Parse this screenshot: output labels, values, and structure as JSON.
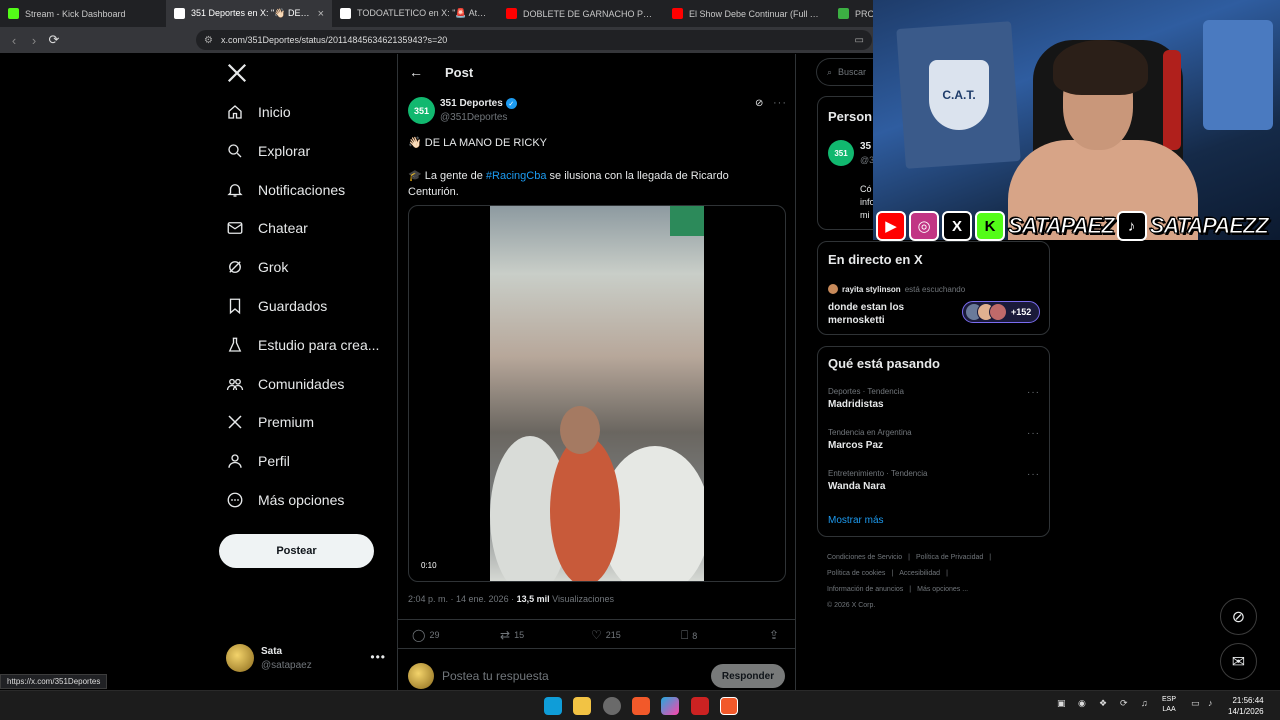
{
  "browser": {
    "tabs": [
      {
        "title": "Stream - Kick Dashboard",
        "color": "#53fc18",
        "active": false
      },
      {
        "title": "351 Deportes en X: \"👋🏻 DE LA M",
        "color": "#ffffff",
        "active": true
      },
      {
        "title": "TODOATLETICO en X: \"🚨 Atención",
        "color": "#ffffff",
        "active": false
      },
      {
        "title": "DOBLETE DE GARNACHO PERO LA P",
        "color": "#ff0000",
        "active": false
      },
      {
        "title": "El Show Debe Continuar (Full Album)",
        "color": "#ff0000",
        "active": false
      },
      {
        "title": "PROMIE",
        "color": "#3cb043",
        "active": false
      }
    ],
    "url": "x.com/351Deportes/status/2011484563462135943?s=20",
    "status_url": "https://x.com/351Deportes"
  },
  "nav": {
    "items": [
      {
        "label": "Inicio",
        "icon": "home-icon"
      },
      {
        "label": "Explorar",
        "icon": "search-icon"
      },
      {
        "label": "Notificaciones",
        "icon": "bell-icon"
      },
      {
        "label": "Chatear",
        "icon": "mail-icon"
      },
      {
        "label": "Grok",
        "icon": "grok-icon"
      },
      {
        "label": "Guardados",
        "icon": "bookmark-icon"
      },
      {
        "label": "Estudio para crea...",
        "icon": "flask-icon"
      },
      {
        "label": "Comunidades",
        "icon": "people-icon"
      },
      {
        "label": "Premium",
        "icon": "x-logo-icon"
      },
      {
        "label": "Perfil",
        "icon": "person-icon"
      },
      {
        "label": "Más opciones",
        "icon": "more-circle-icon"
      }
    ],
    "post_button": "Postear",
    "account": {
      "name": "Sata",
      "handle": "@satapaez"
    }
  },
  "post": {
    "header": "Post",
    "author": {
      "name": "351 Deportes",
      "handle": "@351Deportes",
      "avatar_text": "351"
    },
    "line1": "👋🏻 DE LA MANO DE RICKY",
    "line2_prefix": "🎓 La gente de ",
    "hashtag": "#RacingCba",
    "line2_suffix": " se ilusiona con la llegada de Ricardo Centurión.",
    "video_duration": "0:10",
    "time": "2:04 p. m. · 14 ene. 2026 · ",
    "views_count": "13,5 mil",
    "views_label": " Visualizaciones",
    "stats": {
      "replies": "29",
      "reposts": "15",
      "likes": "215",
      "bookmarks": "8"
    },
    "reply_placeholder": "Postea tu respuesta",
    "reply_button": "Responder"
  },
  "sidebar": {
    "search_placeholder": "Buscar",
    "persons": {
      "title": "Person",
      "name": "35",
      "handle": "@3",
      "text_lines": [
        "Có",
        "info",
        "mi"
      ]
    },
    "live": {
      "title": "En directo en X",
      "host": "rayita stylinson",
      "host_status": "está escuchando",
      "space_title": "donde estan los mernosketti",
      "listeners": "+152"
    },
    "trends": {
      "title": "Qué está pasando",
      "items": [
        {
          "context": "Deportes · Tendencia",
          "name": "Madridistas"
        },
        {
          "context": "Tendencia en Argentina",
          "name": "Marcos Paz"
        },
        {
          "context": "Entretenimiento · Tendencia",
          "name": "Wanda Nara"
        }
      ],
      "show_more": "Mostrar más"
    },
    "footer": {
      "links": [
        "Condiciones de Servicio",
        "|",
        "Política de Privacidad",
        "|",
        "Política de cookies",
        "|",
        "Accesibilidad",
        "|",
        "Información de anuncios",
        "|",
        "Más opciones ...",
        "© 2026 X Corp."
      ]
    }
  },
  "overlay": {
    "shield_text": "C.A.T.",
    "handle1": "SATAPAEZ",
    "handle2": "SATAPAEZZ"
  },
  "taskbar": {
    "lang_top": "ESP",
    "lang_bottom": "LAA",
    "time": "21:56:44",
    "date": "14/1/2026"
  }
}
